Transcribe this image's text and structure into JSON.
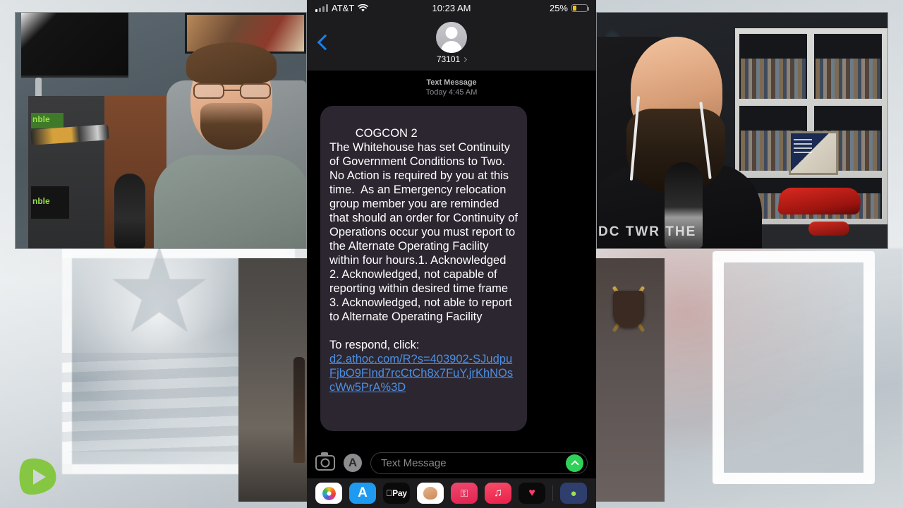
{
  "stream": {
    "platform_logo": "rumble-play-logo",
    "left_cam": {
      "name": "left-webcam-feed",
      "description": "man with glasses and beard in podcast studio",
      "shirt_text": ""
    },
    "right_cam": {
      "name": "right-webcam-feed",
      "description": "bald bearded man with earbuds in bookshelf room",
      "tee_text": "DC TWR  THE"
    }
  },
  "phone": {
    "status_bar": {
      "carrier": "AT&T",
      "time": "10:23 AM",
      "battery_percent": "25%",
      "battery_level": 25,
      "battery_color": "#f5c518",
      "signal_icon": "cellular-bars-icon",
      "wifi_icon": "wifi-icon"
    },
    "nav": {
      "back_icon": "back-chevron-icon",
      "avatar_icon": "contact-avatar-icon",
      "contact_name": "73101",
      "contact_chevron": "chevron-right-icon"
    },
    "thread": {
      "service_label": "Text Message",
      "timestamp": "Today 4:45 AM",
      "message": {
        "body": "COGCON 2\nThe Whitehouse has set Continuity of Government Conditions to Two. No Action is required by you at this time.  As an Emergency relocation group member you are reminded that should an order for Continuity of Operations occur you must report to the Alternate Operating Facility within four hours.1. Acknowledged 2. Acknowledged, not capable of reporting within desired time frame 3. Acknowledged, not able to report to Alternate Operating Facility",
        "respond_label": "To respond, click:",
        "link_text": "d2.athoc.com/R?s=403902-SJudpuFjbO9FInd7rcCtCh8x7FuY,jrKhNOscWw5PrA%3D",
        "bubble_color": "#2b2630",
        "link_color": "#4f8fe0"
      }
    },
    "input_bar": {
      "camera_icon": "camera-icon",
      "app_store_icon": "app-store-icon",
      "placeholder": "Text Message",
      "send_icon": "send-arrow-icon",
      "send_color": "#30d158"
    },
    "app_drawer": [
      {
        "name": "photos-icon",
        "label": ""
      },
      {
        "name": "app-store-icon",
        "label": "A"
      },
      {
        "name": "apple-pay-icon",
        "label": "Pay"
      },
      {
        "name": "memoji-icon",
        "label": ""
      },
      {
        "name": "images-search-icon",
        "label": "⌕"
      },
      {
        "name": "music-icon",
        "label": "♫"
      },
      {
        "name": "digital-touch-icon",
        "label": "♥"
      },
      {
        "name": "more-apps-icon",
        "label": "⊕"
      }
    ]
  }
}
